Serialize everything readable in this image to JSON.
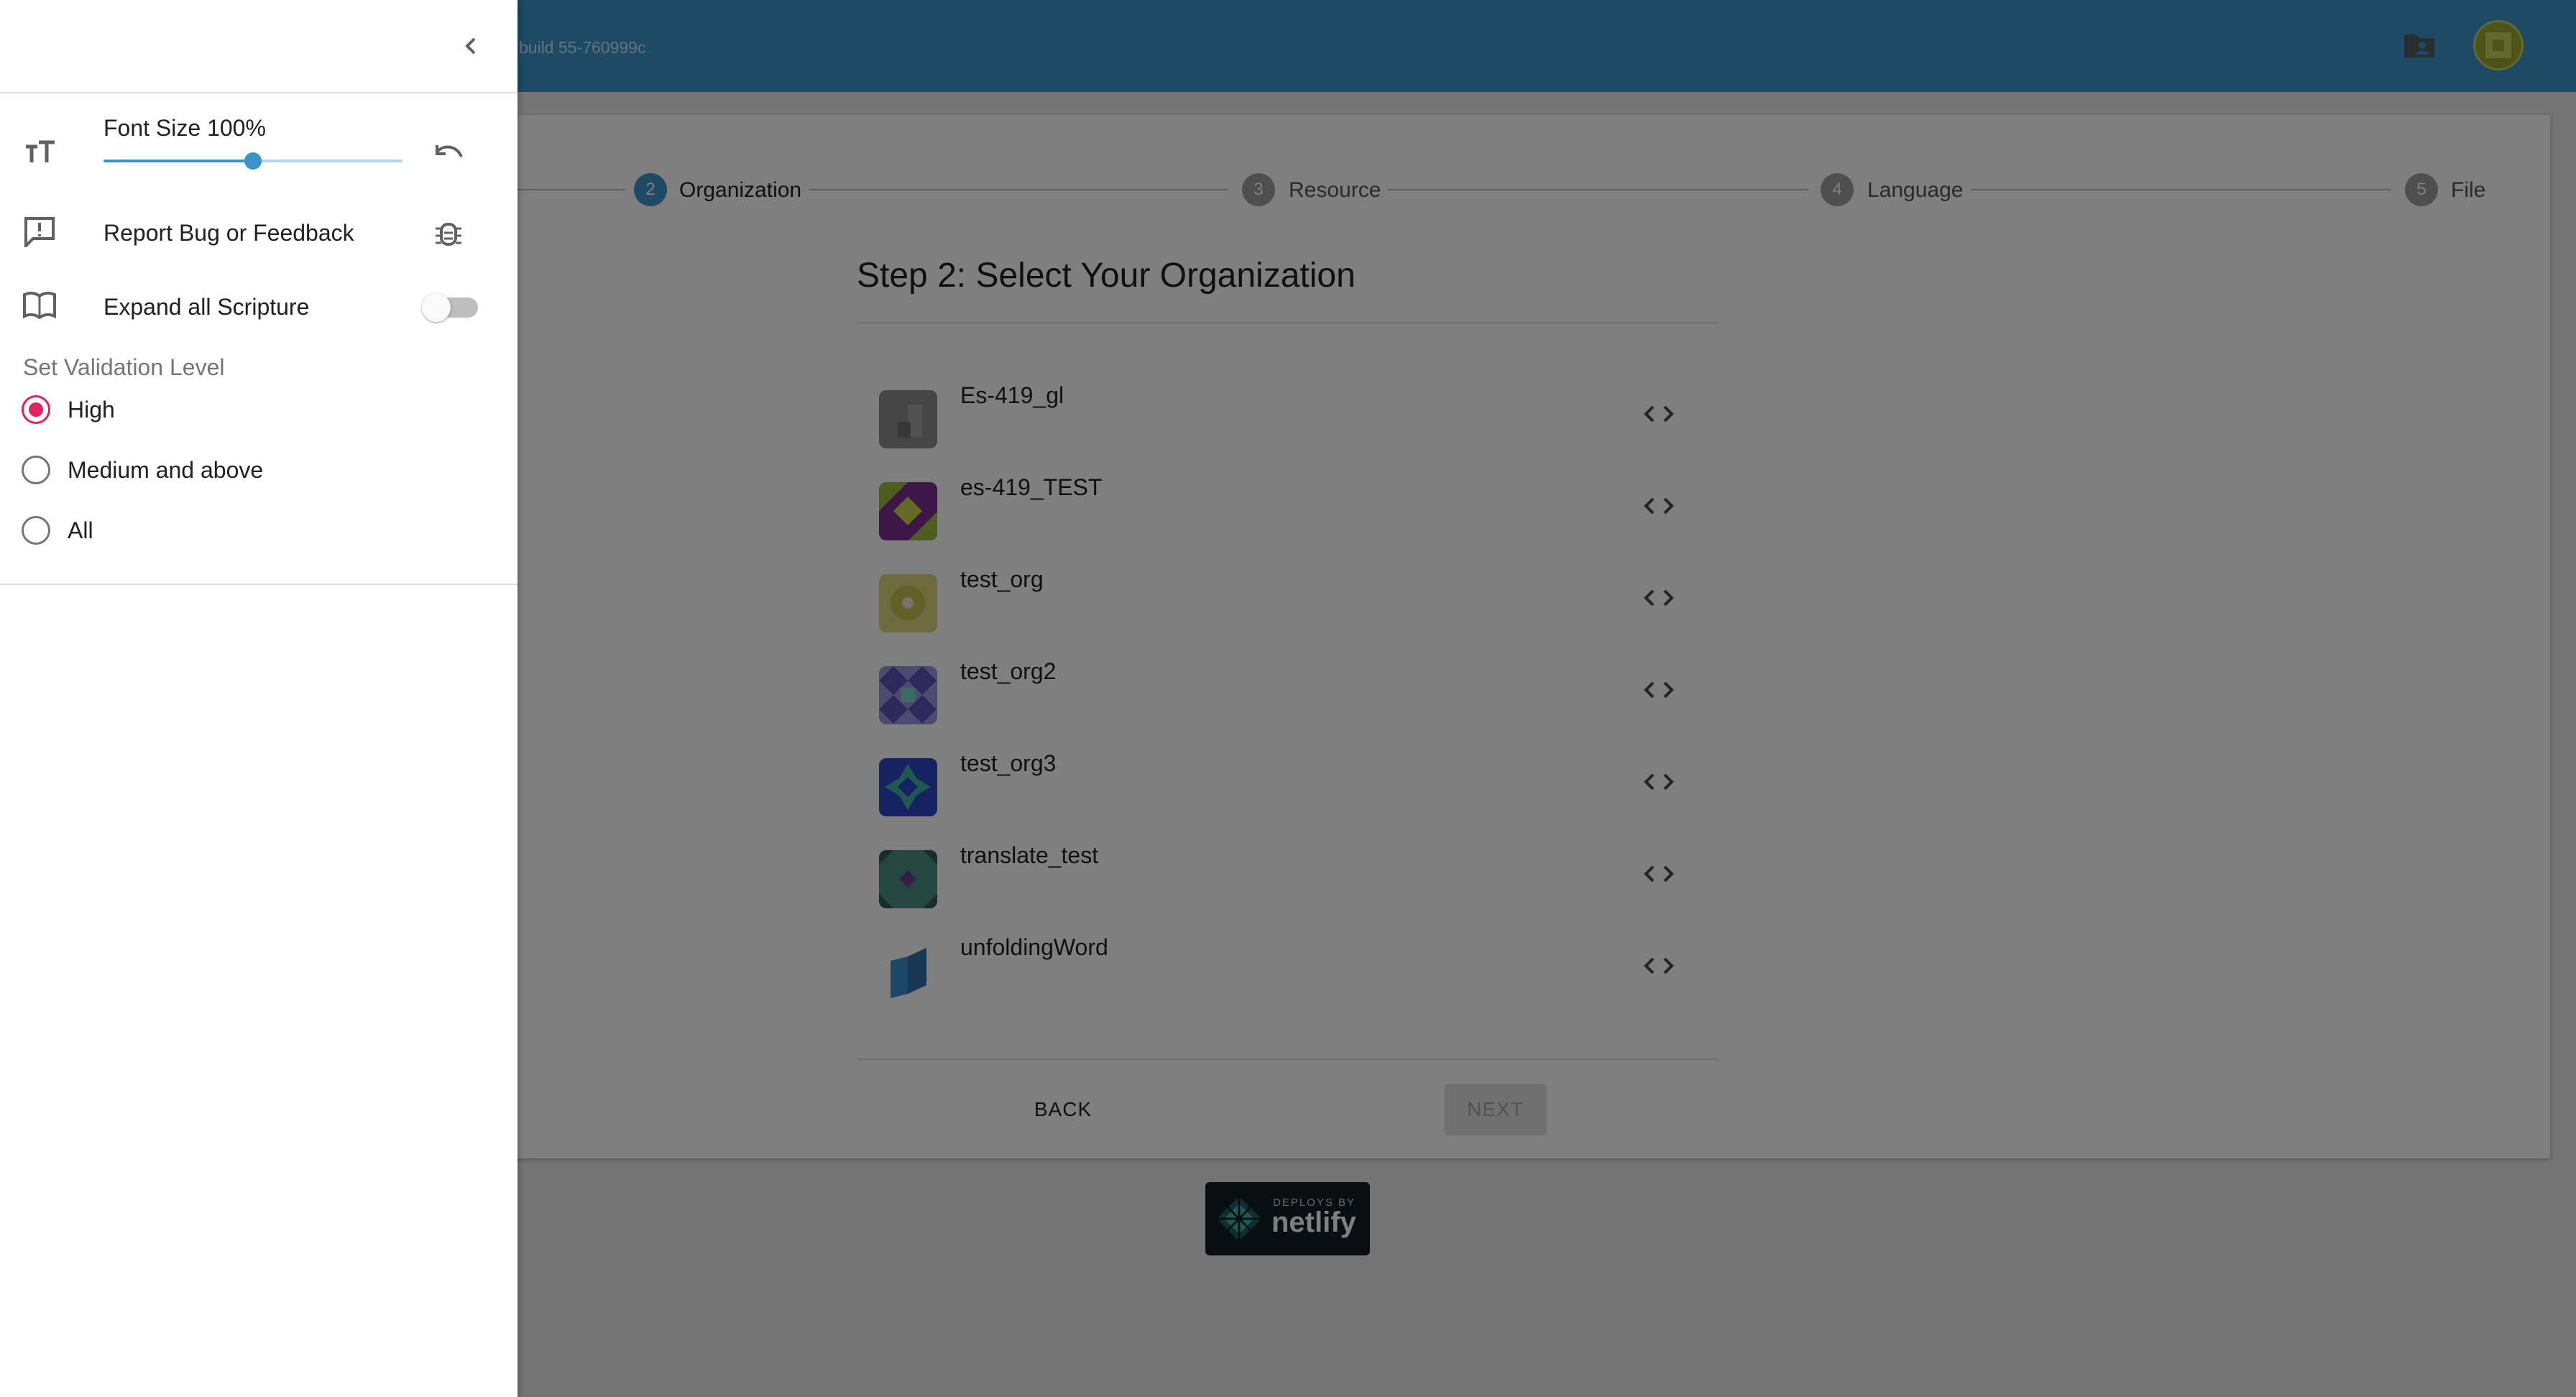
{
  "header": {
    "build_text": "build 55-760999c",
    "icons": [
      "folder-user-icon",
      "user-avatar"
    ]
  },
  "stepper": {
    "steps": [
      {
        "number": "2",
        "label": "Organization",
        "active": true
      },
      {
        "number": "3",
        "label": "Resource",
        "active": false
      },
      {
        "number": "4",
        "label": "Language",
        "active": false
      },
      {
        "number": "5",
        "label": "File",
        "active": false
      }
    ]
  },
  "main": {
    "title": "Step 2: Select Your Organization",
    "organizations": [
      {
        "name": "Es-419_gl",
        "avatar_color": "#8a8a8a"
      },
      {
        "name": "es-419_TEST",
        "avatar_color": "#7b2d8e"
      },
      {
        "name": "test_org",
        "avatar_color": "#c9c463"
      },
      {
        "name": "test_org2",
        "avatar_color": "#6a61c2"
      },
      {
        "name": "test_org3",
        "avatar_color": "#2c47c7"
      },
      {
        "name": "translate_test",
        "avatar_color": "#3f7b74"
      },
      {
        "name": "unfoldingWord",
        "avatar_color": "#2f6fa6"
      }
    ],
    "back_label": "BACK",
    "next_label": "NEXT"
  },
  "footer": {
    "badge_small": "DEPLOYS BY",
    "badge_big": "netlify"
  },
  "drawer": {
    "font_size_label": "Font Size 100%",
    "font_size_percent": 100,
    "font_slider_fraction": 0.5,
    "report_label": "Report Bug or Feedback",
    "expand_label": "Expand all Scripture",
    "expand_enabled": false,
    "validation_heading": "Set Validation Level",
    "validation_options": [
      {
        "label": "High",
        "selected": true
      },
      {
        "label": "Medium and above",
        "selected": false
      },
      {
        "label": "All",
        "selected": false
      }
    ]
  },
  "colors": {
    "primary": "#3a94c9",
    "radio_accent": "#e0245e"
  }
}
